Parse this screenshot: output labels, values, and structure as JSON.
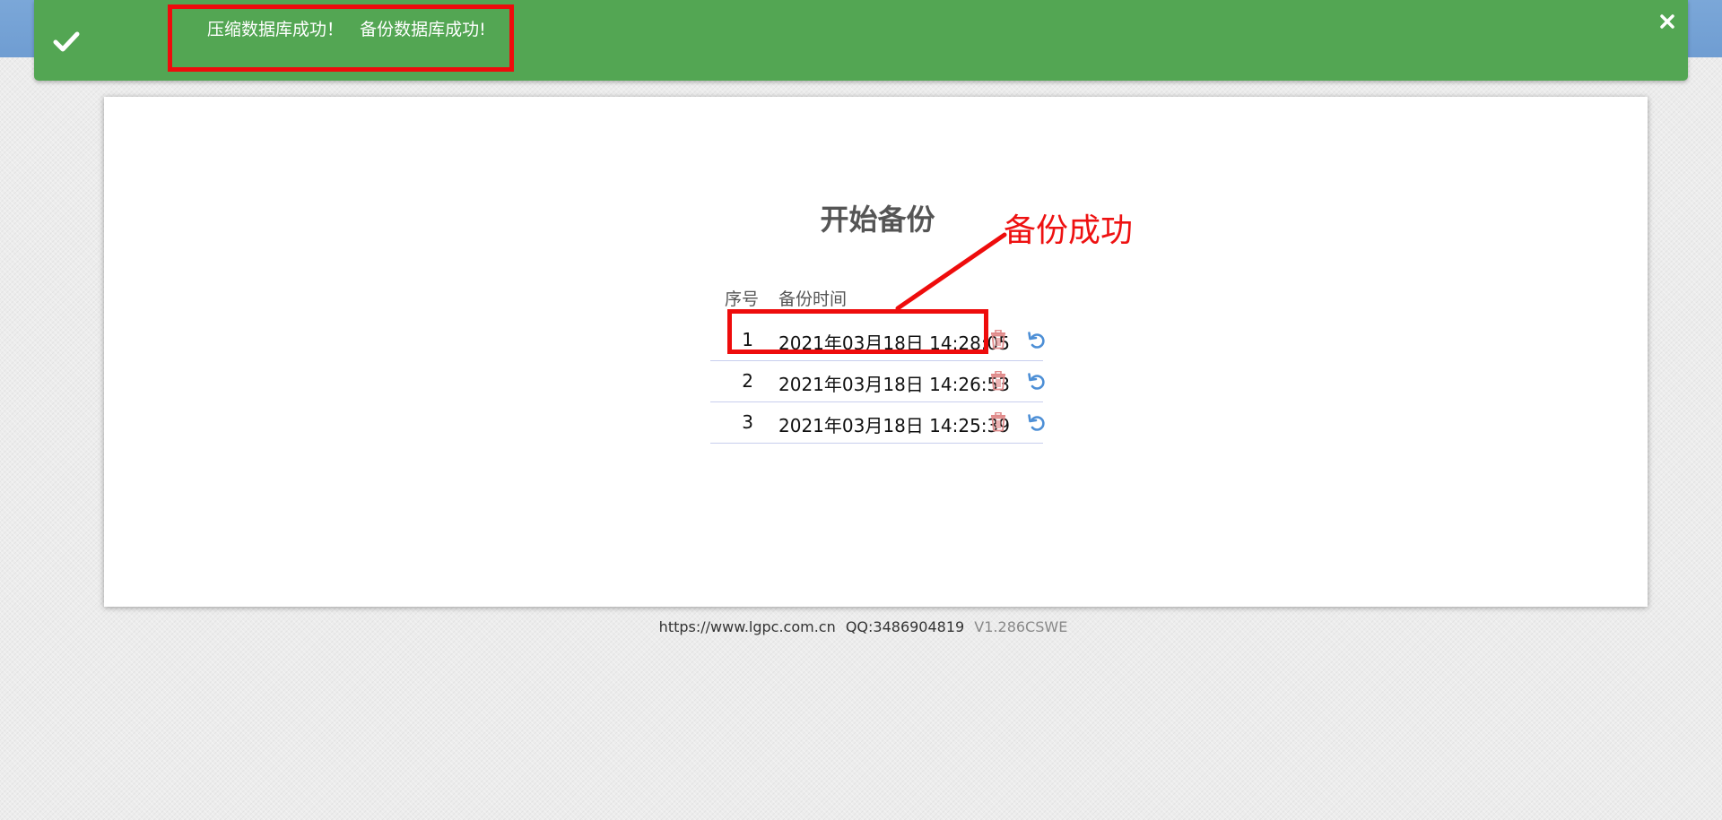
{
  "notification": {
    "message": "压缩数据库成功！   备份数据库成功!",
    "status": "success",
    "color": "#53a653",
    "icon": "check-icon",
    "close_icon": "close-icon"
  },
  "main": {
    "title": "开始备份",
    "table": {
      "columns": [
        "序号",
        "备份时间"
      ],
      "rows": [
        {
          "index": "1",
          "time": "2021年03月18日 14:28:05"
        },
        {
          "index": "2",
          "time": "2021年03月18日 14:26:53"
        },
        {
          "index": "3",
          "time": "2021年03月18日 14:25:39"
        }
      ],
      "row_actions": [
        "trash-icon",
        "restore-icon"
      ]
    }
  },
  "annotation": {
    "label": "备份成功",
    "color": "#ee0c0c"
  },
  "footer": {
    "site": "https://www.lgpc.com.cn",
    "qq": "QQ:3486904819",
    "version": "V1.286CSWE"
  }
}
